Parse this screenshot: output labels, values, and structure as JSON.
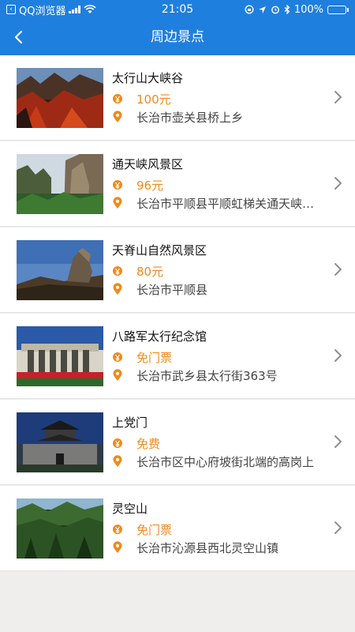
{
  "status_bar": {
    "app_name": "QQ浏览器",
    "time": "21:05",
    "battery_percent": "100%"
  },
  "nav": {
    "title": "周边景点"
  },
  "colors": {
    "header": "#1f7fde",
    "price": "#f08a1c",
    "icon": "#f08a1c"
  },
  "icons": {
    "price": "yen-badge-icon",
    "location": "location-pin-icon",
    "detail": "chevron-right-icon"
  },
  "attractions": [
    {
      "name": "太行山大峡谷",
      "price": "100元",
      "address": "长治市壶关县桥上乡"
    },
    {
      "name": "通天峡风景区",
      "price": "96元",
      "address": "长治市平顺县平顺虹梯关通天峡景区"
    },
    {
      "name": "天脊山自然风景区",
      "price": "80元",
      "address": "长治市平顺县"
    },
    {
      "name": "八路军太行纪念馆",
      "price": "免门票",
      "address": "长治市武乡县太行街363号"
    },
    {
      "name": "上党门",
      "price": "免费",
      "address": "长治市区中心府坡街北端的高岗上"
    },
    {
      "name": "灵空山",
      "price": "免门票",
      "address": "长治市沁源县西北灵空山镇"
    }
  ]
}
